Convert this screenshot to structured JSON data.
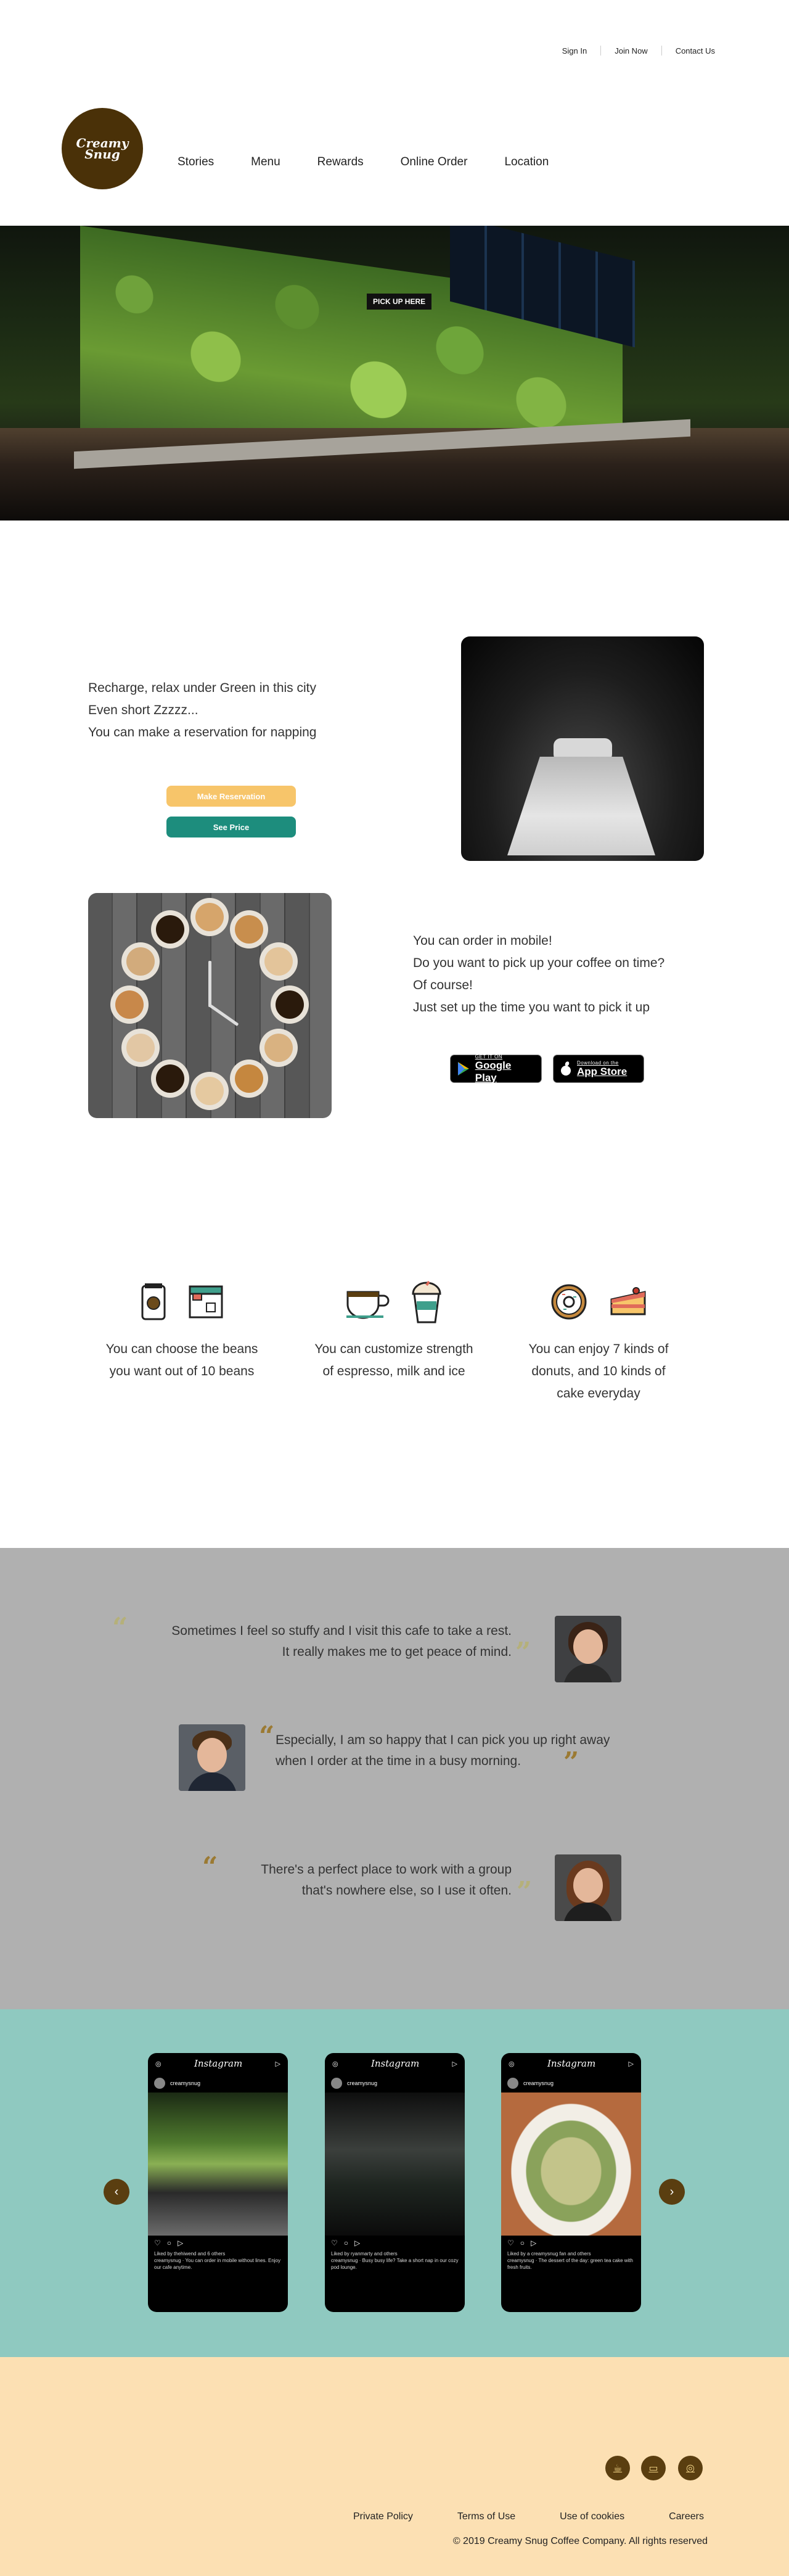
{
  "top_links": [
    "Sign In",
    "Join Now",
    "Contact Us"
  ],
  "logo": {
    "line1": "Creamy",
    "line2": "Snug",
    "icon": "coffee-swirl-logo"
  },
  "nav": [
    "Stories",
    "Menu",
    "Rewards",
    "Online Order",
    "Location"
  ],
  "hero": {
    "sign": "PICK UP HERE"
  },
  "nap": {
    "lines": [
      "Recharge, relax under Green in this city",
      "Even short Zzzzz...",
      "You can make a reservation for napping"
    ],
    "reserve_label": "Make Reservation",
    "price_label": "See Price"
  },
  "mobile": {
    "lines": [
      "You can order in mobile!",
      "Do you want to pick up your coffee on time?",
      "Of course!",
      "Just set up the time you want to pick it up"
    ],
    "google_play": {
      "small": "GET IT ON",
      "big": "Google Play"
    },
    "app_store": {
      "small": "Download on the",
      "big": "App Store"
    }
  },
  "features": [
    {
      "icons": [
        "coffee-bag-icon",
        "espresso-machine-icon"
      ],
      "text": "You can choose the beans you want out of 10 beans"
    },
    {
      "icons": [
        "coffee-cup-icon",
        "iced-drink-icon"
      ],
      "text": "You can customize strength of espresso, milk and ice"
    },
    {
      "icons": [
        "donut-icon",
        "cake-slice-icon"
      ],
      "text": "You can enjoy 7 kinds of donuts, and 10 kinds of cake everyday"
    }
  ],
  "testimonials": [
    {
      "line1": "Sometimes I feel so stuffy and I visit this cafe to take a rest.",
      "line2": "It really makes me to get peace of mind."
    },
    {
      "line1": "Especially, I am so happy that I can pick you up right away",
      "line2": "when I order at the time in a busy morning."
    },
    {
      "line1": "There's a perfect place to work with a group",
      "line2": "that's nowhere else, so I use it often."
    }
  ],
  "instagram": {
    "brand": "Instagram",
    "username": "creamysnug",
    "posts": [
      {
        "likes": "Liked by thehiwend and 6 others",
        "caption": "creamysnug · You can order in mobile without lines. Enjoy our cafe anytime."
      },
      {
        "likes": "Liked by ryanmarty and others",
        "caption": "creamysnug · Busy busy life? Take a short nap in our cozy pod lounge."
      },
      {
        "likes": "Liked by a creamysnug fan and others",
        "caption": "creamysnug · The dessert of the day: green tea cake with fresh fruits."
      }
    ],
    "prev": "‹",
    "next": "›"
  },
  "footer": {
    "links": [
      "Private Policy",
      "Terms of Use",
      "Use of cookies",
      "Careers"
    ],
    "copyright": "© 2019 Creamy Snug Coffee Company. All rights reserved"
  },
  "colors": {
    "brown": "#4a3108",
    "teal": "#1d8d7d",
    "yellow": "#f7c56a",
    "gray": "#b0b0b0",
    "mint": "#8fc9c0",
    "cream": "#fce0b3"
  }
}
